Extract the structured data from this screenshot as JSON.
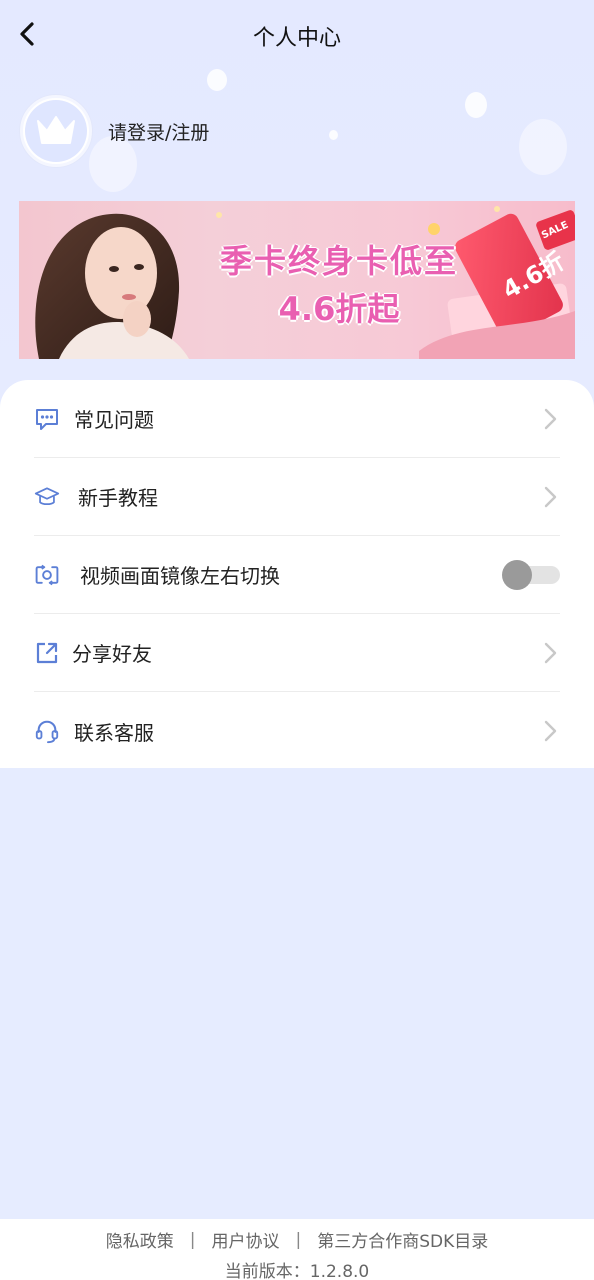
{
  "header": {
    "title": "个人中心"
  },
  "profile": {
    "login_text": "请登录/注册"
  },
  "banner": {
    "line1": "季卡终身卡低至",
    "line2": "4.6折起",
    "badge": "4.6折",
    "sale": "SALE"
  },
  "menu": {
    "items": [
      {
        "label": "常见问题",
        "icon": "chat-bubble-icon",
        "control": "chevron"
      },
      {
        "label": "新手教程",
        "icon": "graduation-cap-icon",
        "control": "chevron"
      },
      {
        "label": "视频画面镜像左右切换",
        "icon": "mirror-camera-icon",
        "control": "toggle",
        "toggle_on": false
      },
      {
        "label": "分享好友",
        "icon": "share-icon",
        "control": "chevron"
      },
      {
        "label": "联系客服",
        "icon": "headset-icon",
        "control": "chevron"
      }
    ]
  },
  "footer": {
    "privacy": "隐私政策",
    "sep1": "|",
    "user_agreement": "用户协议",
    "sep2": "|",
    "sdk_list": "第三方合作商SDK目录",
    "version": "当前版本：1.2.8.0"
  },
  "colors": {
    "background": "#e6ecff",
    "icon_blue": "#5c7fd6",
    "banner_text": "#e95fb1"
  }
}
